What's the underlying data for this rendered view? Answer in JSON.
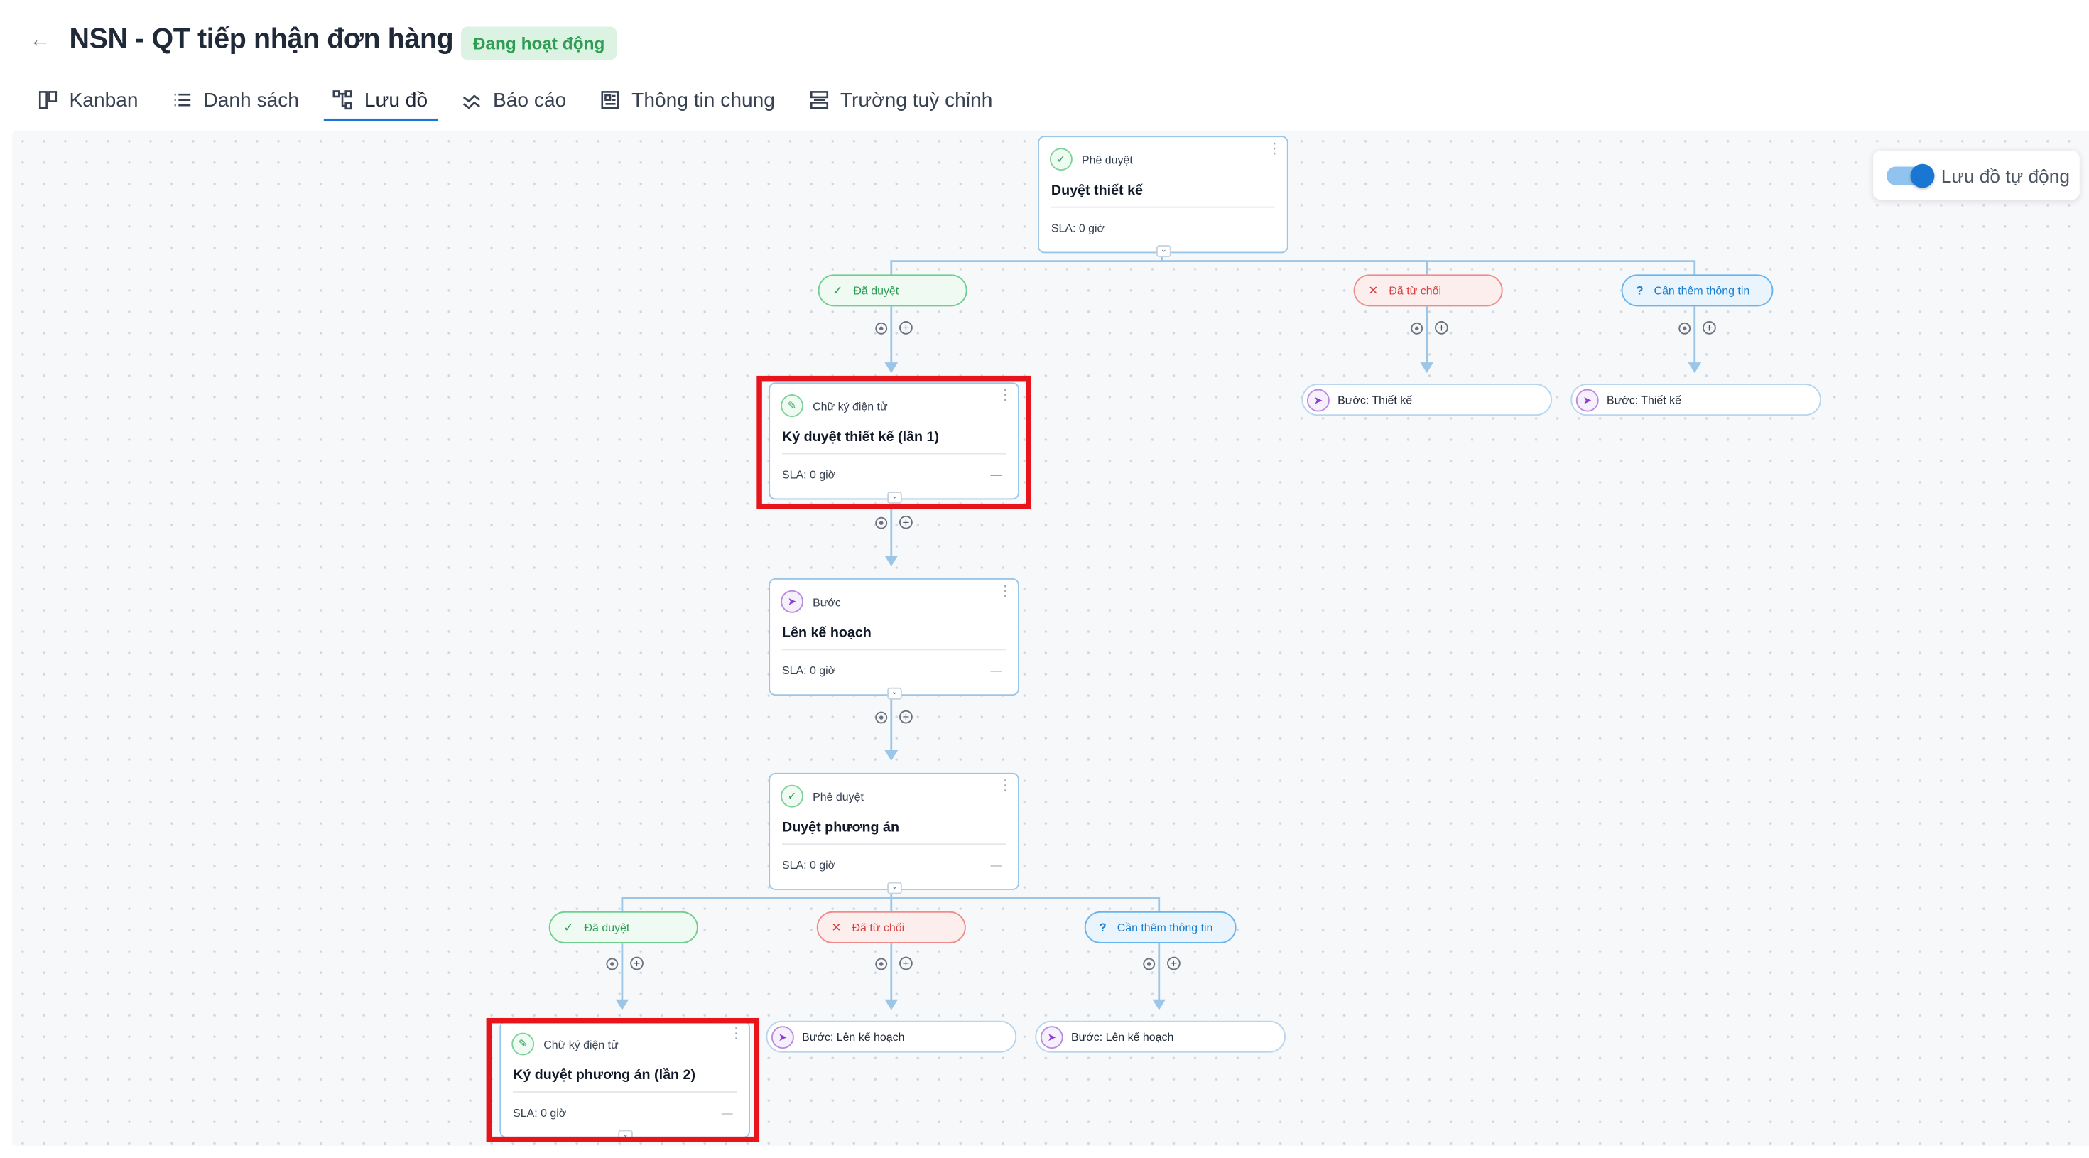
{
  "header": {
    "title": "NSN - QT tiếp nhận đơn hàng",
    "status": "Đang hoạt động",
    "status_color": "#2f9e55"
  },
  "tabs": [
    {
      "label": "Kanban",
      "icon": "kanban-icon"
    },
    {
      "label": "Danh sách",
      "icon": "list-icon"
    },
    {
      "label": "Lưu đồ",
      "icon": "flowchart-icon",
      "active": true
    },
    {
      "label": "Báo cáo",
      "icon": "report-icon"
    },
    {
      "label": "Thông tin chung",
      "icon": "info-icon"
    },
    {
      "label": "Trường tuỳ chỉnh",
      "icon": "custom-fields-icon"
    }
  ],
  "toggle": {
    "label": "Lưu đồ tự động",
    "on": true,
    "accent": "#1976d2"
  },
  "flow": {
    "nodes": {
      "n1": {
        "type": "Phê duyệt",
        "name": "Duyệt thiết kế",
        "sla": "SLA: 0 giờ",
        "dash": "—"
      },
      "n2": {
        "type": "Chữ ký điện tử",
        "name": "Ký duyệt thiết kế (lần 1)",
        "sla": "SLA: 0 giờ",
        "dash": "—"
      },
      "n3": {
        "type": "Bước",
        "name": "Lên kế hoạch",
        "sla": "SLA: 0 giờ",
        "dash": "—"
      },
      "n4": {
        "type": "Phê duyệt",
        "name": "Duyệt phương án",
        "sla": "SLA: 0 giờ",
        "dash": "—"
      },
      "n5": {
        "type": "Chữ ký điện tử",
        "name": "Ký duyệt phương án (lần 2)",
        "sla": "SLA: 0 giờ",
        "dash": "—"
      }
    },
    "outcomes": {
      "approved": "Đã duyệt",
      "rejected": "Đã từ chối",
      "need_info": "Cần thêm thông tin"
    },
    "refs": {
      "r1": "Bước: Thiết kế",
      "r2": "Bước: Thiết kế",
      "r3": "Bước: Lên kế hoạch",
      "r4": "Bước: Lên kế hoạch"
    }
  }
}
